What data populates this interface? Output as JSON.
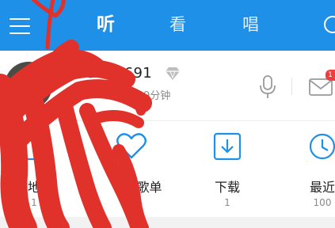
{
  "header": {
    "tabs": [
      {
        "label": "听",
        "active": true
      },
      {
        "label": "看",
        "active": false
      },
      {
        "label": "唱",
        "active": false
      }
    ],
    "menu_icon": "hamburger-menu-icon",
    "search_icon": "search-icon",
    "background_color": "#1e90e8"
  },
  "profile": {
    "username": "b3257691",
    "listen_time": "57529分钟",
    "vip_icon": "diamond-icon",
    "mic_icon": "microphone-icon",
    "mail_icon": "mail-icon",
    "mail_badge": "1"
  },
  "shortcuts": [
    {
      "label": "地",
      "count": "1",
      "icon": "local-music-icon"
    },
    {
      "label": "·歌单",
      "count": "1",
      "icon": "heart-icon"
    },
    {
      "label": "下载",
      "count": "1",
      "icon": "download-icon"
    },
    {
      "label": "最近",
      "count": "100",
      "icon": "clock-icon"
    }
  ],
  "accent_color": "#1e90e8",
  "overlay_color": "#e0312b"
}
